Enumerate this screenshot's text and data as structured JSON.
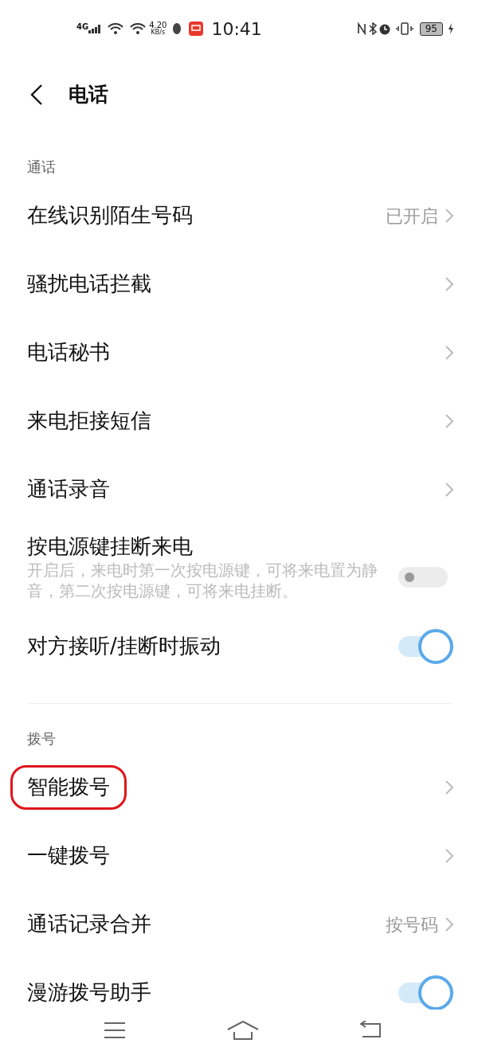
{
  "status_bar": {
    "network": "4G",
    "speed": "4.20",
    "speed_unit": "KB/s",
    "time": "10:41",
    "battery": "95"
  },
  "header": {
    "title": "电话"
  },
  "sections": [
    {
      "label": "通话",
      "items": [
        {
          "kind": "link",
          "title": "在线识别陌生号码",
          "value": "已开启"
        },
        {
          "kind": "link",
          "title": "骚扰电话拦截"
        },
        {
          "kind": "link",
          "title": "电话秘书"
        },
        {
          "kind": "link",
          "title": "来电拒接短信"
        },
        {
          "kind": "link",
          "title": "通话录音"
        },
        {
          "kind": "switch",
          "title": "按电源键挂断来电",
          "description": "开启后，来电时第一次按电源键，可将来电置为静音，第二次按电源键，可将来电挂断。",
          "on": false
        },
        {
          "kind": "switch",
          "title": "对方接听/挂断时振动",
          "on": true
        }
      ]
    },
    {
      "label": "拨号",
      "items": [
        {
          "kind": "link",
          "title": "智能拨号",
          "highlighted": true
        },
        {
          "kind": "link",
          "title": "一键拨号"
        },
        {
          "kind": "link",
          "title": "通话记录合并",
          "value": "按号码"
        },
        {
          "kind": "switch",
          "title": "漫游拨号助手",
          "on": true
        }
      ]
    }
  ]
}
